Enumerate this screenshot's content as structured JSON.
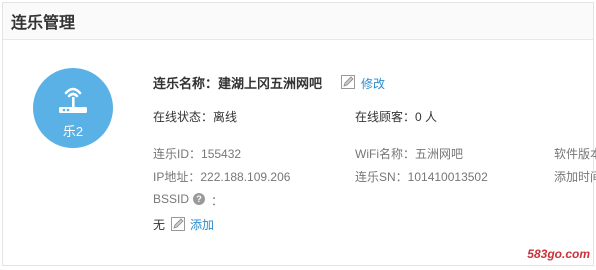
{
  "panel": {
    "title": "连乐管理"
  },
  "device": {
    "badge": "乐2",
    "name_label": "连乐名称：",
    "name_value": "建湖上冈五洲网吧",
    "edit_label": "修改"
  },
  "status": {
    "online_label": "在线状态：",
    "online_value": "离线",
    "customers_label": "在线顾客：",
    "customers_value": "0 人"
  },
  "details": {
    "id_label": "连乐ID：",
    "id_value": "155432",
    "wifi_label": "WiFi名称：",
    "wifi_value": "五洲网吧",
    "software_label": "软件版本",
    "ip_label": "IP地址：",
    "ip_value": "222.188.109.206",
    "sn_label": "连乐SN：",
    "sn_value": "101410013502",
    "added_label": "添加时间",
    "bssid_label": "BSSID",
    "bssid_colon": "：",
    "bssid_value": "无",
    "bssid_add_label": "添加"
  },
  "watermark": "583go.com",
  "colors": {
    "accent": "#59b1e6",
    "link": "#2d8ccc"
  },
  "icons": {
    "device": "router-icon",
    "edit": "edit-icon",
    "help": "help-icon"
  }
}
